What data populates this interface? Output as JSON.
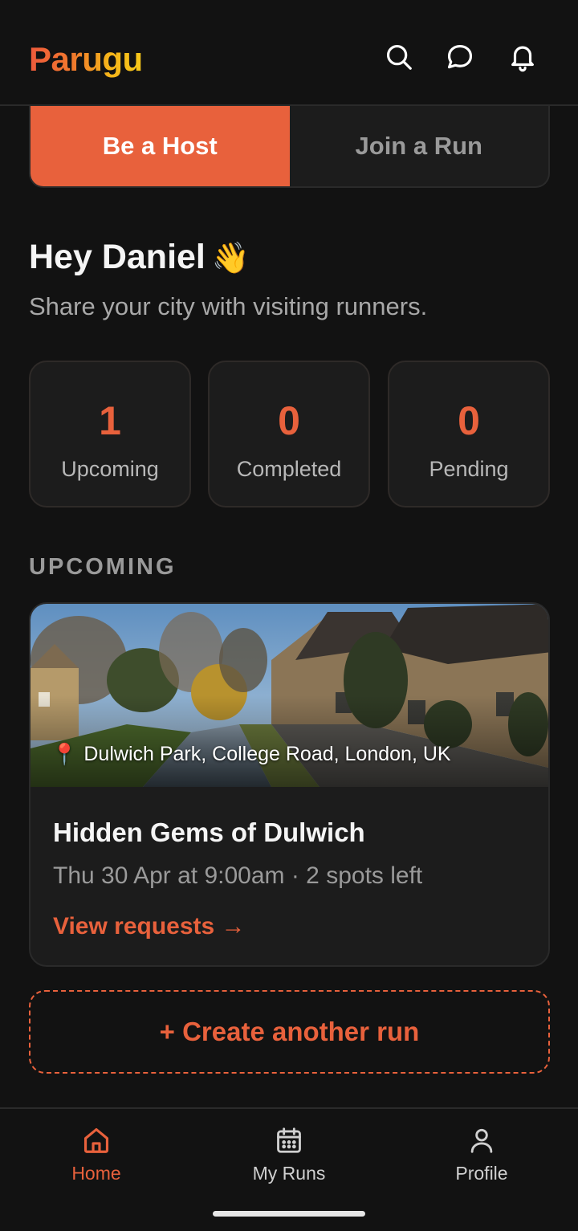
{
  "app": {
    "logo": "Parugu"
  },
  "header_icons": [
    "search-icon",
    "chat-icon",
    "bell-icon"
  ],
  "toggle": {
    "host_label": "Be a Host",
    "join_label": "Join a Run"
  },
  "greeting": {
    "text": "Hey Daniel",
    "emoji": "👋",
    "subtitle": "Share your city with visiting runners."
  },
  "stats": [
    {
      "value": "1",
      "label": "Upcoming"
    },
    {
      "value": "0",
      "label": "Completed"
    },
    {
      "value": "0",
      "label": "Pending"
    }
  ],
  "section": {
    "upcoming_label": "UPCOMING"
  },
  "run_card": {
    "location": "Dulwich Park, College Road, London, UK",
    "title": "Hidden Gems of Dulwich",
    "meta": "Thu 30 Apr at 9:00am · 2 spots left",
    "link": "View requests →"
  },
  "create_button": "+ Create another run",
  "tabs": [
    {
      "label": "Home",
      "icon": "home-icon",
      "active": true
    },
    {
      "label": "My Runs",
      "icon": "calendar-icon",
      "active": false
    },
    {
      "label": "Profile",
      "icon": "person-icon",
      "active": false
    }
  ],
  "colors": {
    "accent": "#e8613c",
    "background": "#121212",
    "card": "#1c1c1c"
  }
}
